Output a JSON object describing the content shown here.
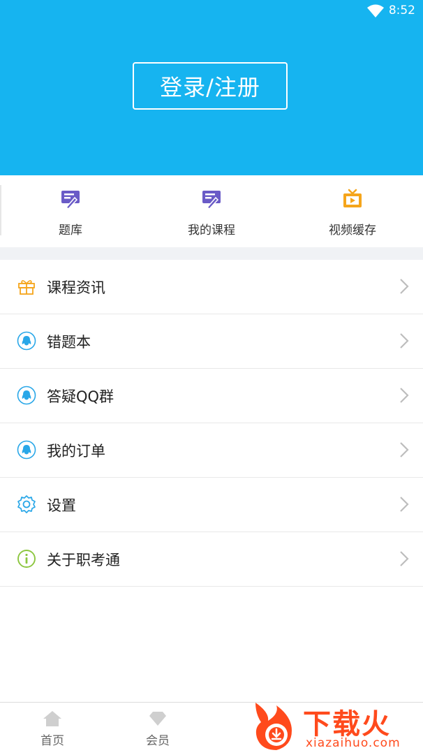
{
  "status_bar": {
    "time": "8:52",
    "wifi_icon": "wifi-icon"
  },
  "header": {
    "login_label": "登录/注册",
    "bg_color": "#16b4f0"
  },
  "quick_grid": [
    {
      "label": "题库",
      "icon": "question-bank-icon"
    },
    {
      "label": "我的课程",
      "icon": "my-courses-icon"
    },
    {
      "label": "视频缓存",
      "icon": "tv-icon"
    }
  ],
  "menu": [
    {
      "label": "课程资讯",
      "icon": "gift-icon"
    },
    {
      "label": "错题本",
      "icon": "qq-penguin-icon"
    },
    {
      "label": "答疑QQ群",
      "icon": "qq-penguin-icon"
    },
    {
      "label": "我的订单",
      "icon": "qq-penguin-icon"
    },
    {
      "label": "设置",
      "icon": "gear-icon"
    },
    {
      "label": "关于职考通",
      "icon": "info-icon"
    }
  ],
  "bottom_nav": [
    {
      "label": "首页",
      "icon": "home-icon"
    },
    {
      "label": "会员",
      "icon": "diamond-icon"
    }
  ],
  "watermark": {
    "text": "下载火",
    "sub": "xiazaihuo.com"
  }
}
